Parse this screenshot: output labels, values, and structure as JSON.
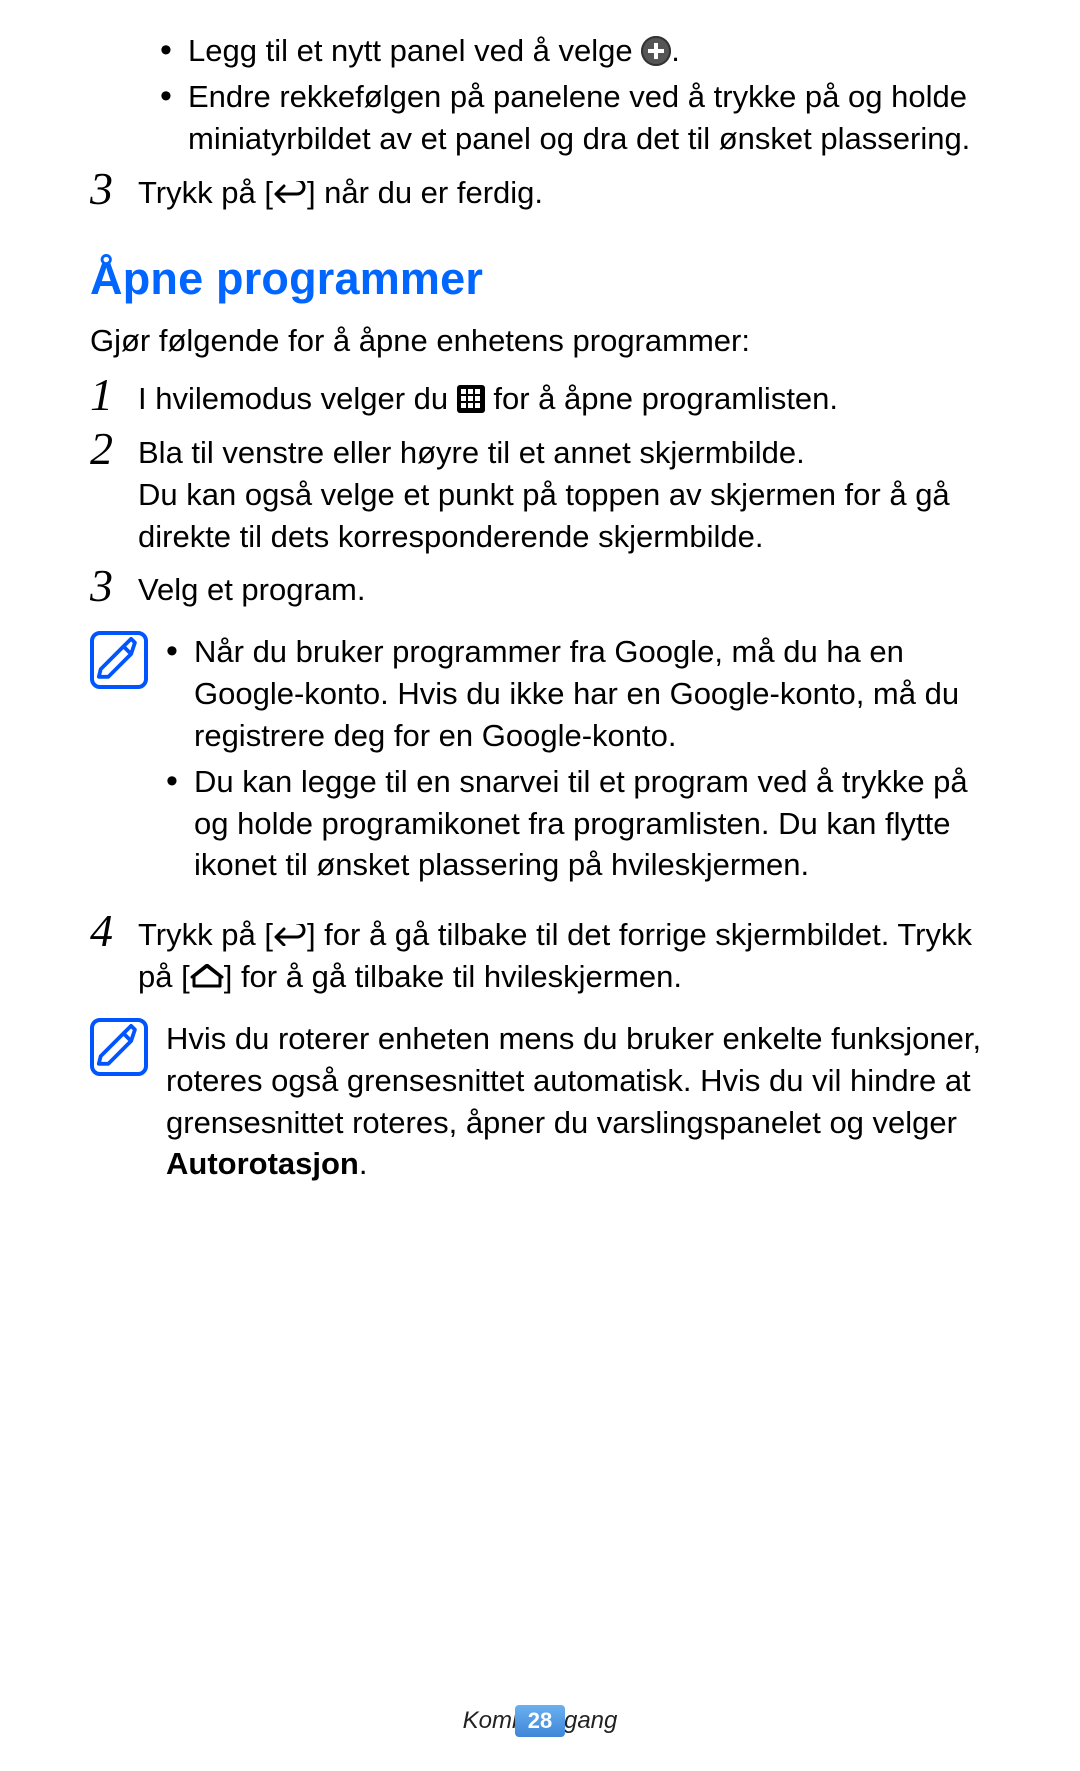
{
  "top_bullets": [
    "Legg til et nytt panel ved å velge ",
    "Endre rekkefølgen på panelene ved å trykke på og holde miniatyrbildet av et panel og dra det til ønsket plassering."
  ],
  "top_bullet0_tail": ".",
  "step3_top_a": "Trykk på [",
  "step3_top_b": "] når du er ferdig.",
  "heading": "Åpne programmer",
  "intro": "Gjør følgende for å åpne enhetens programmer:",
  "step1_a": "I hvilemodus velger du ",
  "step1_b": " for å åpne programlisten.",
  "step2_line1": "Bla til venstre eller høyre til et annet skjermbilde.",
  "step2_line2": "Du kan også velge et punkt på toppen av skjermen for å gå direkte til dets korresponderende skjermbilde.",
  "step3": "Velg et program.",
  "note1_bullets": [
    "Når du bruker programmer fra Google, må du ha en Google-konto. Hvis du ikke har en Google-konto, må du registrere deg for en Google-konto.",
    "Du kan legge til en snarvei til et program ved å trykke på og holde programikonet fra programlisten. Du kan flytte ikonet til ønsket plassering på hvileskjermen."
  ],
  "step4_a": "Trykk på [",
  "step4_b": "] for å gå tilbake til det forrige skjermbildet. Trykk på [",
  "step4_c": "] for å gå tilbake til hvileskjermen.",
  "note2_a": "Hvis du roterer enheten mens du bruker enkelte funksjoner, roteres også grensesnittet automatisk. Hvis du vil hindre at grensesnittet roteres, åpner du varslingspanelet og velger ",
  "note2_bold": "Autorotasjon",
  "note2_b": ".",
  "numbers": {
    "n1": "1",
    "n2": "2",
    "n3": "3",
    "n4": "4"
  },
  "footer": "Komme i gang",
  "page_number": "28"
}
